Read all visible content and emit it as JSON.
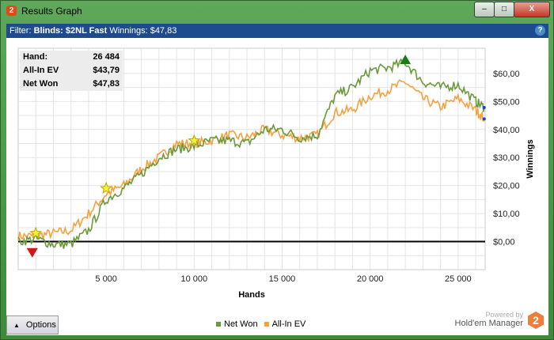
{
  "window": {
    "title": "Results Graph",
    "app_icon": "2"
  },
  "filter": {
    "prefix": "Filter:",
    "blinds": "Blinds: $2NL Fast",
    "winnings": "Winnings: $47,83",
    "help": "?"
  },
  "info": {
    "rows": [
      {
        "label": "Hand:",
        "value": "26 484"
      },
      {
        "label": "All-In EV",
        "value": "$43,79"
      },
      {
        "label": "Net Won",
        "value": "$47,83"
      }
    ]
  },
  "chart_data": {
    "type": "line",
    "xlabel": "Hands",
    "ylabel": "Winnings",
    "xlim": [
      0,
      26484
    ],
    "ylim": [
      -10,
      69
    ],
    "x_ticks": [
      {
        "v": 5000,
        "label": "5 000"
      },
      {
        "v": 10000,
        "label": "10 000"
      },
      {
        "v": 15000,
        "label": "15 000"
      },
      {
        "v": 20000,
        "label": "20 000"
      },
      {
        "v": 25000,
        "label": "25 000"
      }
    ],
    "y_ticks": [
      {
        "v": 0,
        "label": "$0,00"
      },
      {
        "v": 10,
        "label": "$10,00"
      },
      {
        "v": 20,
        "label": "$20,00"
      },
      {
        "v": 30,
        "label": "$30,00"
      },
      {
        "v": 40,
        "label": "$40,00"
      },
      {
        "v": 50,
        "label": "$50,00"
      },
      {
        "v": 60,
        "label": "$60,00"
      }
    ],
    "x": [
      0,
      1000,
      2000,
      3000,
      4000,
      5000,
      6000,
      7000,
      8000,
      9000,
      10000,
      11000,
      12000,
      13000,
      14000,
      15000,
      16000,
      17000,
      18000,
      19000,
      20000,
      21000,
      22000,
      23000,
      24000,
      25000,
      26000,
      26484
    ],
    "series": [
      {
        "name": "Net Won",
        "color": "#6a9a3a",
        "values": [
          0,
          1,
          -1,
          -1,
          4,
          15,
          19,
          24,
          30,
          33,
          34,
          36,
          36,
          35,
          40,
          40,
          37,
          38,
          52,
          55,
          61,
          62,
          64,
          57,
          55,
          56,
          50,
          47.83
        ]
      },
      {
        "name": "All-In EV",
        "color": "#f7a040",
        "values": [
          2,
          2,
          3,
          4,
          10,
          17,
          20,
          26,
          30,
          35,
          35,
          36,
          38,
          37,
          40,
          38,
          37,
          38,
          46,
          47,
          52,
          54,
          57,
          51,
          48,
          51,
          47,
          43.79
        ]
      }
    ],
    "markers": [
      {
        "type": "star",
        "x": 1000,
        "y": 3
      },
      {
        "type": "star",
        "x": 5000,
        "y": 19
      },
      {
        "type": "star",
        "x": 10000,
        "y": 36
      },
      {
        "type": "max",
        "x": 22000,
        "y": 65
      },
      {
        "type": "min",
        "x": 800,
        "y": -4
      }
    ],
    "legend": "bottom"
  },
  "options_label": "Options",
  "brand": {
    "powered": "Powered by",
    "name": "Hold'em Manager",
    "logo": "2"
  }
}
